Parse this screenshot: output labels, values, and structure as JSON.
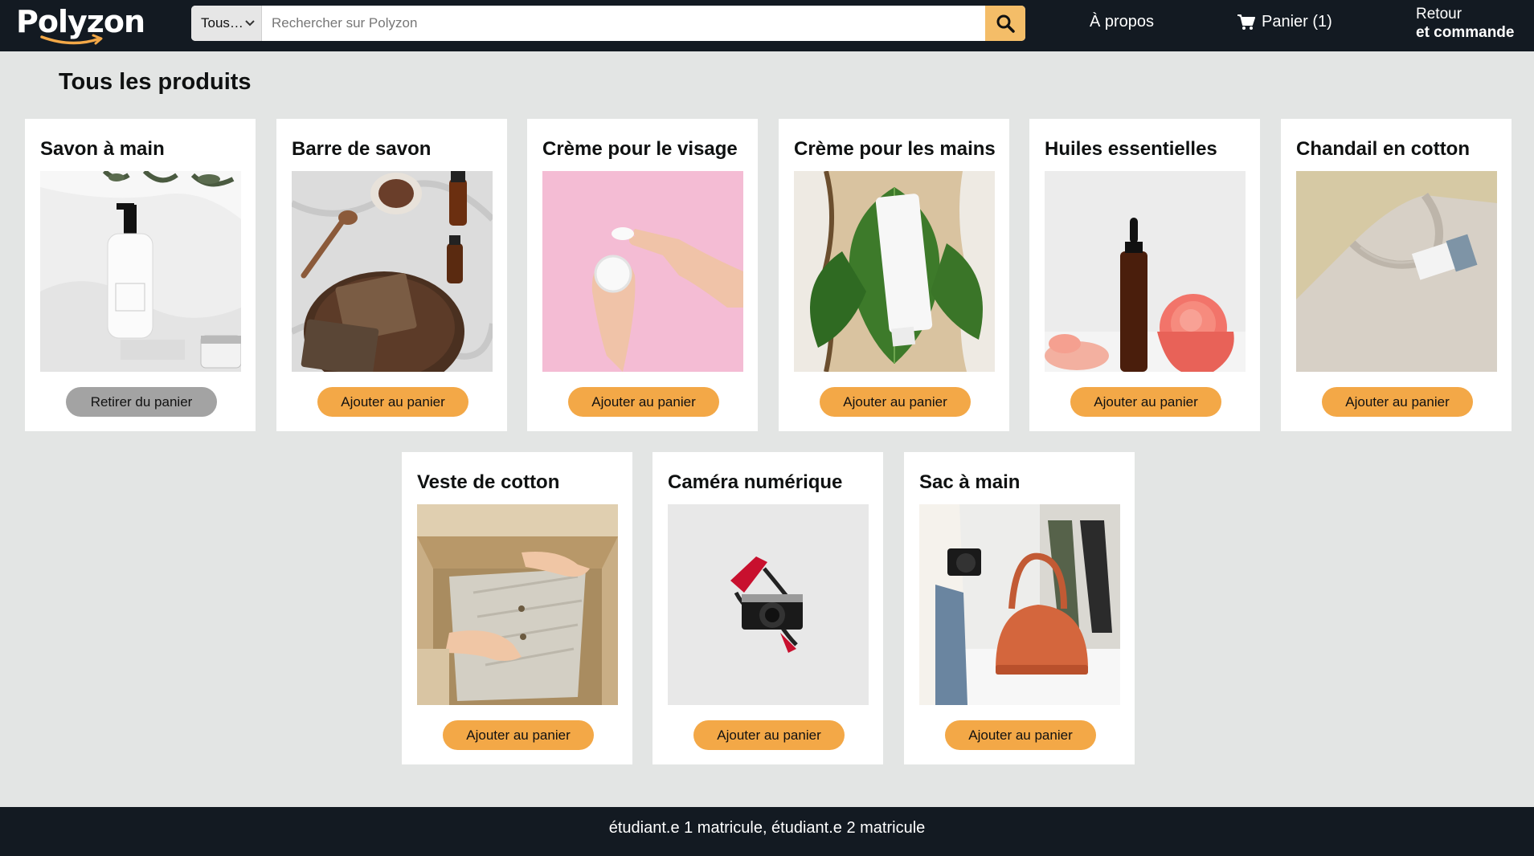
{
  "header": {
    "logo": "Polyzon",
    "search": {
      "category": "Tous…",
      "placeholder": "Rechercher sur Polyzon",
      "value": ""
    },
    "about_label": "À propos",
    "cart_label": "Panier (1)",
    "returns_line1": "Retour",
    "returns_line2": "et commande"
  },
  "main": {
    "title": "Tous les produits",
    "products": [
      {
        "name": "Savon à main",
        "button": "Retirer du panier",
        "in_cart": true
      },
      {
        "name": "Barre de savon",
        "button": "Ajouter au panier",
        "in_cart": false
      },
      {
        "name": "Crème pour le visage",
        "button": "Ajouter au panier",
        "in_cart": false
      },
      {
        "name": "Crème pour les mains",
        "button": "Ajouter au panier",
        "in_cart": false
      },
      {
        "name": "Huiles essentielles",
        "button": "Ajouter au panier",
        "in_cart": false
      },
      {
        "name": "Chandail en cotton",
        "button": "Ajouter au panier",
        "in_cart": false
      },
      {
        "name": "Veste de cotton",
        "button": "Ajouter au panier",
        "in_cart": false
      },
      {
        "name": "Caméra numérique",
        "button": "Ajouter au panier",
        "in_cart": false
      },
      {
        "name": "Sac à main",
        "button": "Ajouter au panier",
        "in_cart": false
      }
    ]
  },
  "footer": {
    "text": "étudiant.e 1 matricule, étudiant.e 2 matricule"
  },
  "colors": {
    "header_bg": "#131a22",
    "page_bg": "#e3e5e4",
    "accent": "#f3a847",
    "remove_button": "#a3a3a3"
  }
}
